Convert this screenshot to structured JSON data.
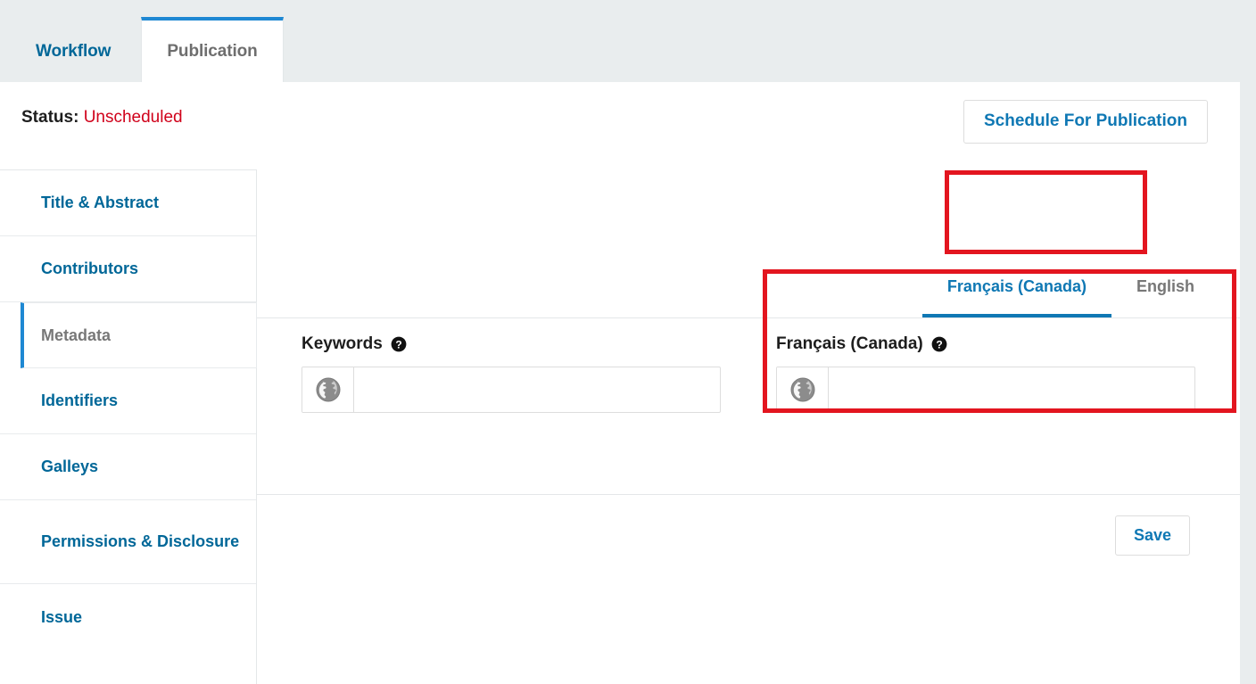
{
  "top_tabs": [
    {
      "label": "Workflow",
      "active": false
    },
    {
      "label": "Publication",
      "active": true
    }
  ],
  "status": {
    "label": "Status:",
    "value": "Unscheduled",
    "value_color": "#d0021b"
  },
  "header": {
    "schedule_button": "Schedule For Publication"
  },
  "sidebar": {
    "items": [
      {
        "label": "Title & Abstract",
        "active": false
      },
      {
        "label": "Contributors",
        "active": false
      },
      {
        "label": "Metadata",
        "active": true
      },
      {
        "label": "Identifiers",
        "active": false
      },
      {
        "label": "Galleys",
        "active": false
      },
      {
        "label": "Permissions & Disclosure",
        "active": false
      },
      {
        "label": "Issue",
        "active": false
      }
    ]
  },
  "language_tabs": [
    {
      "label": "Français (Canada)",
      "active": true
    },
    {
      "label": "English",
      "active": false
    }
  ],
  "form": {
    "fields": [
      {
        "label": "Keywords",
        "help_icon": "help-circle-icon",
        "input_icon": "globe-icon",
        "value": "",
        "placeholder": ""
      },
      {
        "label": "Français (Canada)",
        "help_icon": "help-circle-icon",
        "input_icon": "globe-icon",
        "value": "",
        "placeholder": ""
      }
    ],
    "save_button": "Save"
  },
  "annotations": [
    {
      "name": "language-tab-highlight",
      "color": "#e3151f"
    },
    {
      "name": "french-keywords-field-highlight",
      "color": "#e3151f"
    }
  ],
  "colors": {
    "accent_blue": "#006798",
    "tab_blue": "#1e88d3",
    "link_blue": "#0f78b4",
    "status_red": "#d0021b",
    "annotation_red": "#e3151f",
    "page_bg": "#e9edee",
    "panel_bg": "#ffffff",
    "border_gray": "#e4e7e9",
    "muted_text": "#787878"
  }
}
